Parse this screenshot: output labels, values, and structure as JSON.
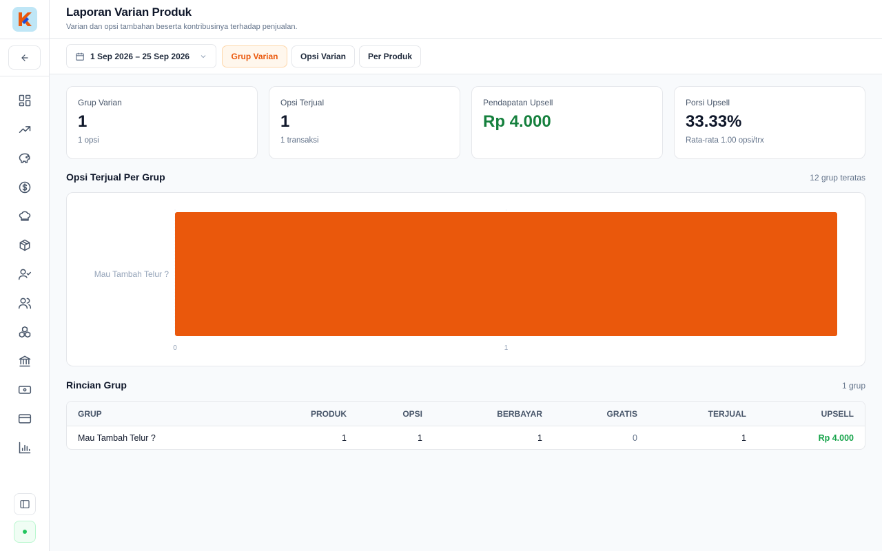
{
  "header": {
    "title": "Laporan Varian Produk",
    "subtitle": "Varian dan opsi tambahan beserta kontribusinya terhadap penjualan."
  },
  "filters": {
    "date_range": "1 Sep 2026 – 25 Sep 2026",
    "tabs": [
      {
        "label": "Grup Varian",
        "active": true
      },
      {
        "label": "Opsi Varian",
        "active": false
      },
      {
        "label": "Per Produk",
        "active": false
      }
    ]
  },
  "stats": [
    {
      "label": "Grup Varian",
      "value": "1",
      "sub": "1 opsi"
    },
    {
      "label": "Opsi Terjual",
      "value": "1",
      "sub": "1 transaksi"
    },
    {
      "label": "Pendapatan Upsell",
      "value": "Rp 4.000",
      "sub": ""
    },
    {
      "label": "Porsi Upsell",
      "value": "33.33%",
      "sub": "Rata-rata 1.00 opsi/trx"
    }
  ],
  "chart_section": {
    "title": "Opsi Terjual Per Grup",
    "meta": "12 grup teratas"
  },
  "chart_data": {
    "type": "bar",
    "orientation": "horizontal",
    "categories": [
      "Mau Tambah Telur ?"
    ],
    "values": [
      1
    ],
    "xlim": [
      0,
      2
    ],
    "xticks": [
      "0",
      "1"
    ],
    "color": "#ea580c"
  },
  "table_section": {
    "title": "Rincian Grup",
    "meta": "1 grup"
  },
  "table": {
    "columns": [
      "GRUP",
      "PRODUK",
      "OPSI",
      "BERBAYAR",
      "GRATIS",
      "TERJUAL",
      "UPSELL"
    ],
    "rows": [
      [
        "Mau Tambah Telur ?",
        "1",
        "1",
        "1",
        "0",
        "1",
        "Rp 4.000"
      ]
    ]
  },
  "sidebar": {
    "icons": [
      "dashboard-icon",
      "trending-up-icon",
      "piggy-bank-icon",
      "dollar-icon",
      "chef-hat-icon",
      "package-icon",
      "user-check-icon",
      "users-icon",
      "boxes-icon",
      "bank-icon",
      "banknote-icon",
      "credit-card-icon",
      "bar-chart-icon"
    ]
  },
  "colors": {
    "accent": "#ea580c",
    "success": "#15803d"
  }
}
